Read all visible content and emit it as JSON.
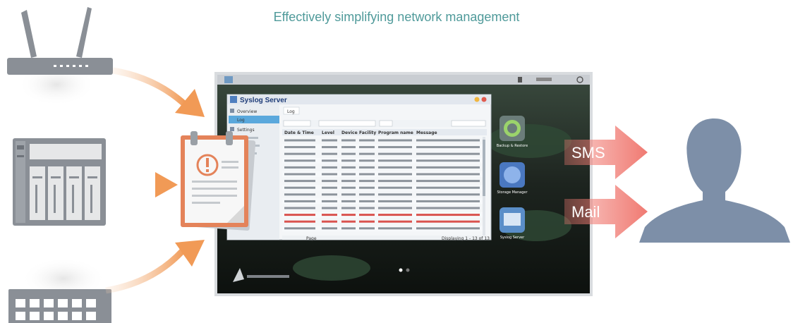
{
  "headline": "Effectively simplifying network management",
  "notifications": {
    "sms_label": "SMS",
    "mail_label": "Mail",
    "arrow_color": "#f07a72"
  },
  "colors": {
    "headline": "#4f9a9a",
    "device_gray": "#8a8f96",
    "orange_arrow": "#f19a56",
    "person_gray": "#7d8fa8"
  },
  "desktop": {
    "window_title": "Syslog Server",
    "sidebar_items": [
      "Overview",
      "Log",
      "Settings"
    ],
    "tab_label": "Log",
    "desktop_icons": [
      "Backup & Restore",
      "Storage Manager",
      "Syslog Server"
    ],
    "table_headers": [
      "Date & Time",
      "Level",
      "Device",
      "Facility",
      "Program name",
      "Message"
    ],
    "page_label": "Page",
    "status_text": "Displaying 1 - 13 of 13"
  },
  "icons": [
    "router-icon",
    "nas-server-icon",
    "network-switch-icon",
    "log-document-icon",
    "alert-icon",
    "user-silhouette-icon"
  ]
}
